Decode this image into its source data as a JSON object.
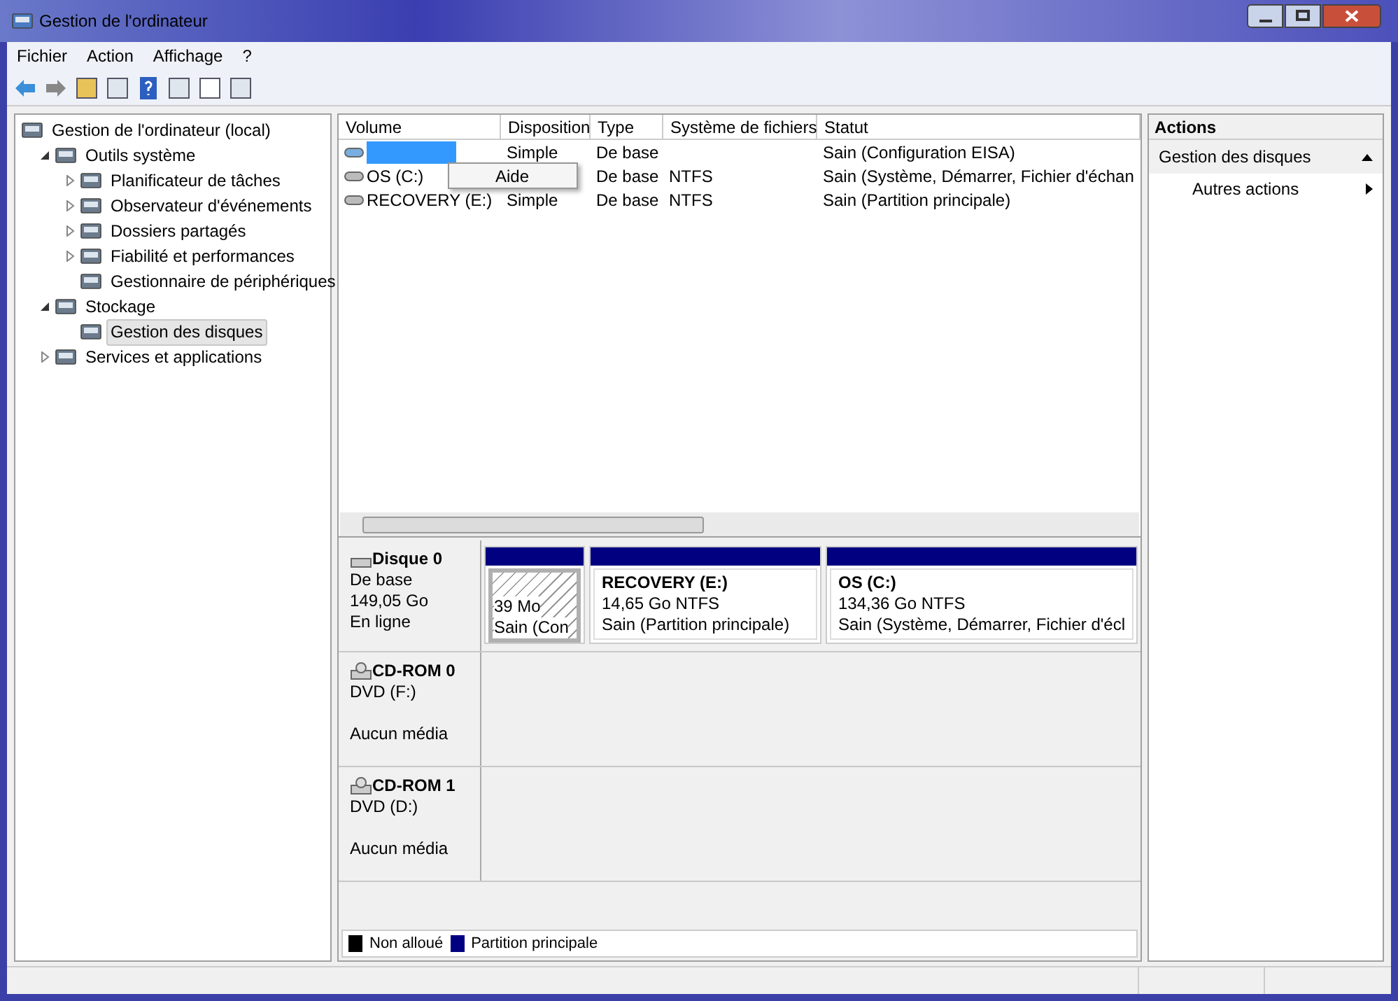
{
  "window": {
    "title": "Gestion de l'ordinateur"
  },
  "menu": [
    "Fichier",
    "Action",
    "Affichage",
    "?"
  ],
  "tree": [
    {
      "label": "Gestion de l'ordinateur (local)",
      "selected": false,
      "children": [
        {
          "label": "Outils système",
          "expanded": true,
          "selected": false,
          "children": [
            {
              "label": "Planificateur de tâches",
              "expanded": false,
              "selected": false
            },
            {
              "label": "Observateur d'événements",
              "expanded": false,
              "selected": false
            },
            {
              "label": "Dossiers partagés",
              "expanded": false,
              "selected": false
            },
            {
              "label": "Fiabilité et performances",
              "expanded": false,
              "selected": false
            },
            {
              "label": "Gestionnaire de périphériques",
              "selected": false
            }
          ]
        },
        {
          "label": "Stockage",
          "expanded": true,
          "selected": false,
          "children": [
            {
              "label": "Gestion des disques",
              "selected": true
            }
          ]
        },
        {
          "label": "Services et applications",
          "expanded": false,
          "selected": false
        }
      ]
    }
  ],
  "table": {
    "columns": [
      "Volume",
      "Disposition",
      "Type",
      "Système de fichiers",
      "Statut"
    ],
    "rows": [
      {
        "disposition": "Simple",
        "type": "De base",
        "status": "Sain (Configuration EISA)",
        "selected": true
      },
      {
        "volume": "OS (C:)",
        "type": "De base",
        "file_system": "NTFS",
        "status": "Sain (Système, Démarrer, Fichier d'échan",
        "selected": false
      },
      {
        "volume": "RECOVERY (E:)",
        "disposition": "Simple",
        "type": "De base",
        "file_system": "NTFS",
        "status": "Sain (Partition principale)",
        "selected": false
      }
    ]
  },
  "context_menu": [
    "Aide"
  ],
  "disks": [
    {
      "name": "Disque 0",
      "kind": "disk",
      "lines": [
        "De base",
        "149,05 Go",
        "En ligne"
      ],
      "partitions": [
        {
          "size": "39 Mo",
          "status": "Sain (Con",
          "selected": true
        },
        {
          "title": "RECOVERY  (E:)",
          "size": "14,65 Go NTFS",
          "status": "Sain (Partition principale)",
          "selected": false
        },
        {
          "title": "OS  (C:)",
          "size": "134,36 Go NTFS",
          "status": "Sain (Système, Démarrer, Fichier d'écl",
          "selected": false
        }
      ]
    },
    {
      "name": "CD-ROM 0",
      "kind": "cdrom",
      "lines": [
        "DVD (F:)",
        "Aucun média"
      ]
    },
    {
      "name": "CD-ROM 1",
      "kind": "cdrom",
      "lines": [
        "DVD (D:)",
        "Aucun média"
      ]
    }
  ],
  "legend": [
    {
      "label": "Non alloué",
      "color": "#000000"
    },
    {
      "label": "Partition principale",
      "color": "#000080"
    }
  ],
  "actions": {
    "title": "Actions",
    "section": {
      "label": "Gestion des disques",
      "expanded": true
    },
    "items": [
      "Autres actions"
    ]
  }
}
